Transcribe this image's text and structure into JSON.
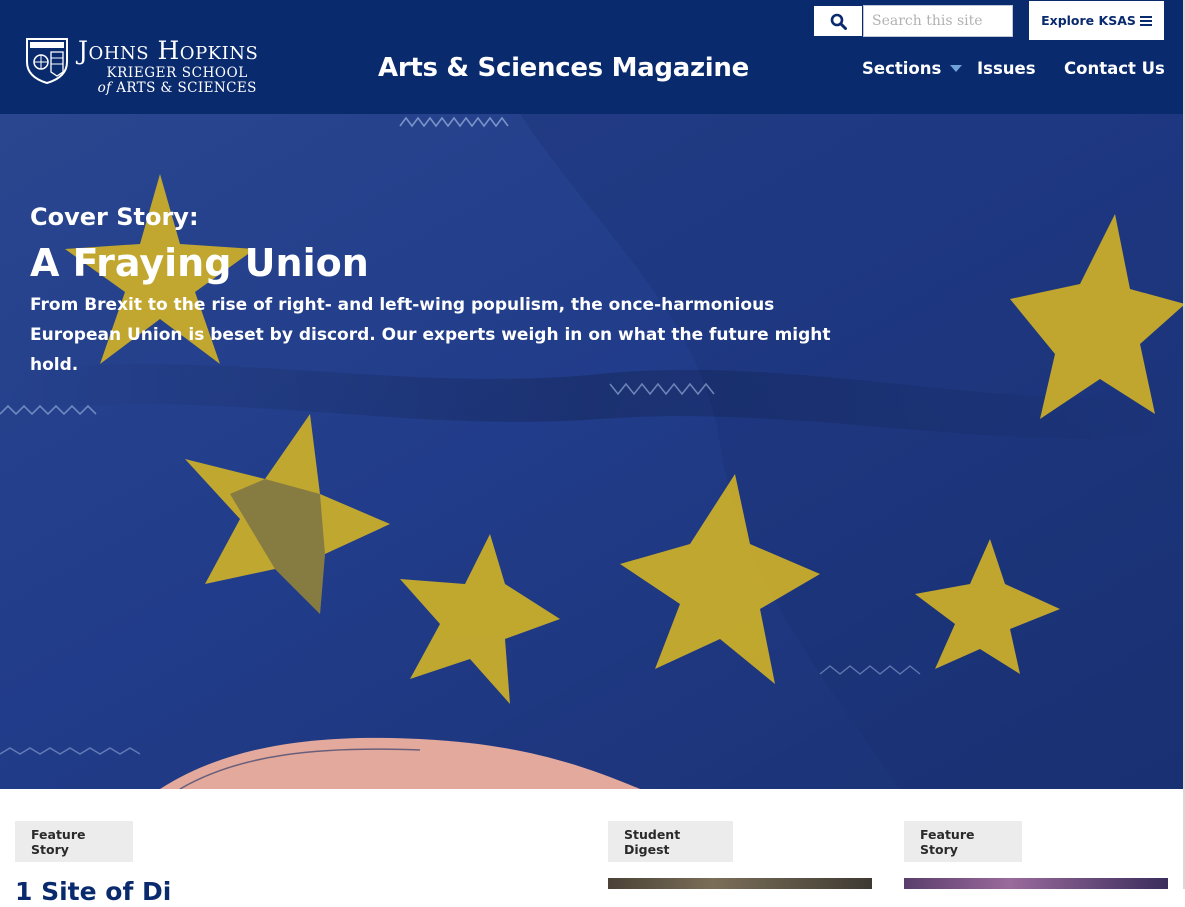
{
  "header": {
    "logo_main": "Johns Hopkins",
    "logo_line2": "KRIEGER SCHOOL",
    "logo_line3_of": "of",
    "logo_line3_rest": "ARTS & SCIENCES",
    "magazine_title": "Arts & Sciences Magazine",
    "search_placeholder": "Search this site",
    "search_value": "",
    "explore_label": "Explore KSAS",
    "nav": {
      "sections": "Sections",
      "issues": "Issues",
      "contact": "Contact Us"
    },
    "colors": {
      "brand": "#0a2a6e",
      "caret": "#6fa3d8"
    }
  },
  "hero": {
    "kicker": "Cover Story:",
    "headline": "A Fraying Union",
    "dek": "From Brexit to the rise of right- and left-wing populism, the once-harmonious European Union is beset by discord. Our experts weigh in on what the future might hold.",
    "colors": {
      "flag_blue": "#1f3a8a",
      "star_yellow": "#c9ad2a"
    }
  },
  "cards": [
    {
      "tag": "Feature Story",
      "title": "1 Site of Di"
    },
    {
      "tag": "Student Digest"
    },
    {
      "tag": "Feature Story"
    }
  ]
}
